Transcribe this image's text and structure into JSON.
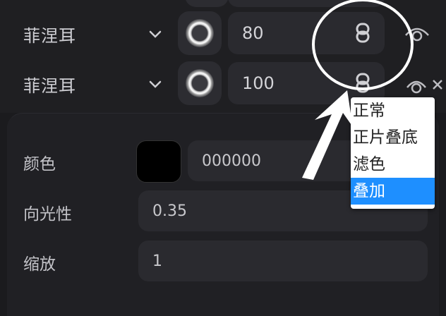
{
  "layers": [
    {
      "name": "菲涅耳",
      "opacity": "80"
    },
    {
      "name": "菲涅耳",
      "opacity": "100"
    }
  ],
  "properties": {
    "color_label": "颜色",
    "color_hex": "000000",
    "color_value": "#000000",
    "direction_label": "向光性",
    "direction_value": "0.35",
    "scale_label": "缩放",
    "scale_value": "1"
  },
  "blend_menu": {
    "options": [
      "正常",
      "正片叠底",
      "滤色",
      "叠加"
    ],
    "selected": "叠加"
  },
  "colors": {
    "background": "#1b1b1e",
    "field": "#2a2a2f",
    "menu_highlight": "#1e8fff"
  }
}
